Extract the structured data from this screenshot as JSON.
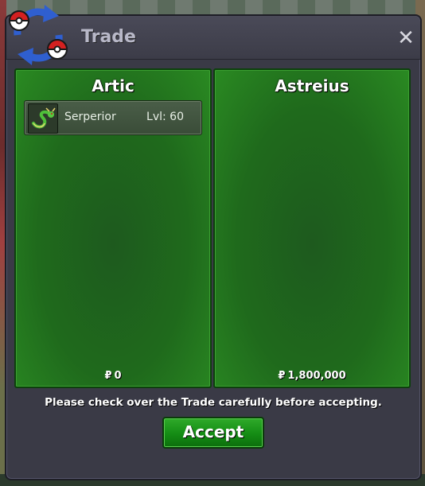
{
  "dialog": {
    "title": "Trade",
    "close_label": "✕",
    "logo_icon": "trade-arrows-icon"
  },
  "left_panel": {
    "trainer": "Artic",
    "money_symbol": "₽",
    "money": "0",
    "items": [
      {
        "name": "Serperior",
        "level": "Lvl: 60",
        "icon": "serperior-sprite-icon"
      }
    ]
  },
  "right_panel": {
    "trainer": "Astreius",
    "money_symbol": "₽",
    "money": "1,800,000",
    "items": []
  },
  "notice": "Please check over the Trade carefully before accepting.",
  "accept_label": "Accept",
  "colors": {
    "panel_green": "#1f6a1c",
    "accept_green": "#148c14",
    "dialog_bg": "#3a3a46"
  }
}
